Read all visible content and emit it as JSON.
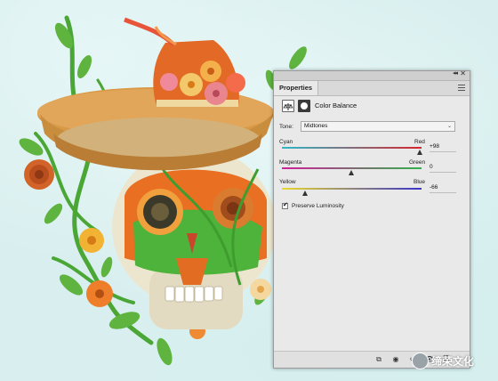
{
  "panel": {
    "tab_label": "Properties",
    "collapse_glyph": "◂◂",
    "close_glyph": "✕",
    "adjustment_title": "Color Balance",
    "adjustment_icon": "color-balance-icon",
    "mask_icon": "layer-mask-icon"
  },
  "tone": {
    "label": "Tone:",
    "selected": "Midtones",
    "chevron": "⌄"
  },
  "sliders": [
    {
      "left_label": "Cyan",
      "right_label": "Red",
      "value": "+98",
      "numeric": 98,
      "gradient": [
        "#2fb7c9",
        "#d8242c"
      ]
    },
    {
      "left_label": "Magenta",
      "right_label": "Green",
      "value": "0",
      "numeric": 0,
      "gradient": [
        "#d21f9a",
        "#2fb24c"
      ]
    },
    {
      "left_label": "Yellow",
      "right_label": "Blue",
      "value": "-66",
      "numeric": -66,
      "gradient": [
        "#e9d82d",
        "#3a34c9"
      ]
    }
  ],
  "preserve_luminosity": {
    "label": "Preserve Luminosity",
    "checked": true,
    "check_glyph": "✔"
  },
  "footer": {
    "icons": [
      "clip-to-layer-icon",
      "view-previous-icon",
      "reset-icon",
      "visibility-eye-icon",
      "delete-icon"
    ],
    "glyphs": [
      "⧉",
      "◉",
      "↺",
      "👁",
      "🗑"
    ]
  },
  "watermark": {
    "text": "缔荣文化",
    "logo": "wechat-logo-icon"
  },
  "colors": {
    "background": "#d9efef",
    "panel_bg": "#e9e9e9",
    "hat_straw": "#c98d3e",
    "hat_orange": "#e36a26",
    "skull": "#ede6cf",
    "leaf": "#3f9c2e"
  }
}
